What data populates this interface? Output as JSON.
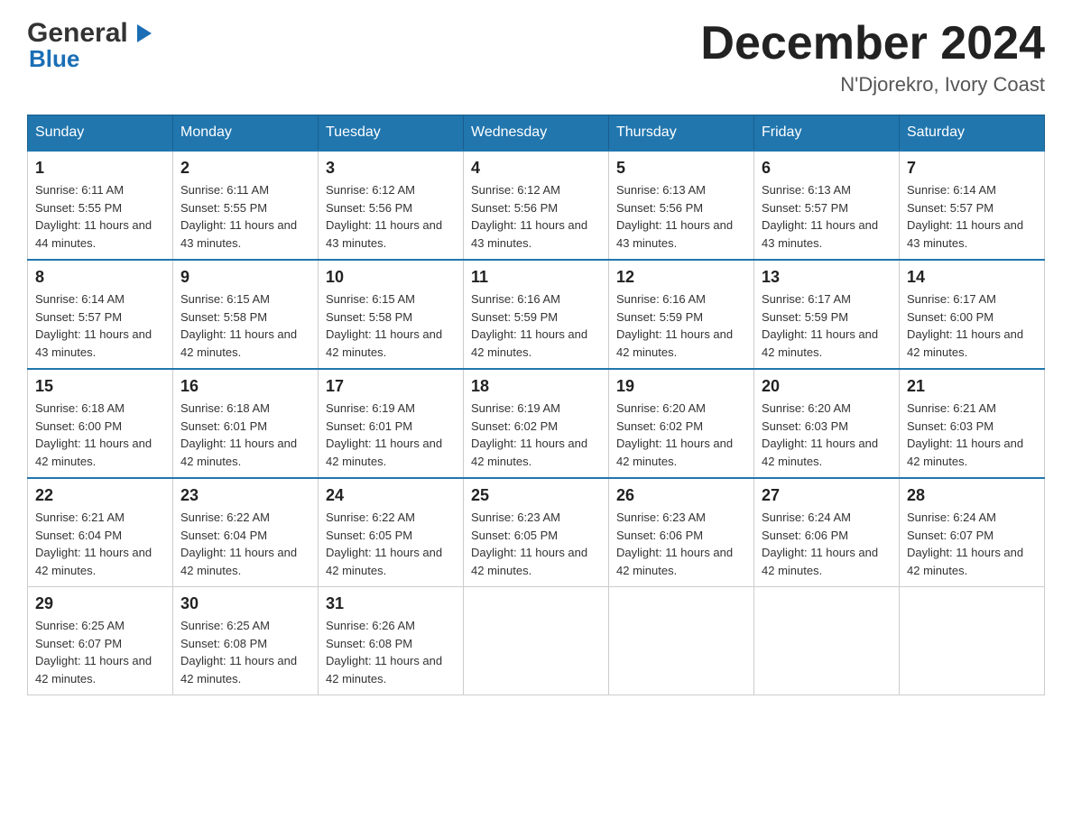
{
  "header": {
    "logo": {
      "general": "General",
      "blue": "Blue",
      "arrow_symbol": "▶"
    },
    "title": "December 2024",
    "location": "N'Djorekro, Ivory Coast"
  },
  "calendar": {
    "days_of_week": [
      "Sunday",
      "Monday",
      "Tuesday",
      "Wednesday",
      "Thursday",
      "Friday",
      "Saturday"
    ],
    "weeks": [
      [
        {
          "day": "1",
          "sunrise": "Sunrise: 6:11 AM",
          "sunset": "Sunset: 5:55 PM",
          "daylight": "Daylight: 11 hours and 44 minutes."
        },
        {
          "day": "2",
          "sunrise": "Sunrise: 6:11 AM",
          "sunset": "Sunset: 5:55 PM",
          "daylight": "Daylight: 11 hours and 43 minutes."
        },
        {
          "day": "3",
          "sunrise": "Sunrise: 6:12 AM",
          "sunset": "Sunset: 5:56 PM",
          "daylight": "Daylight: 11 hours and 43 minutes."
        },
        {
          "day": "4",
          "sunrise": "Sunrise: 6:12 AM",
          "sunset": "Sunset: 5:56 PM",
          "daylight": "Daylight: 11 hours and 43 minutes."
        },
        {
          "day": "5",
          "sunrise": "Sunrise: 6:13 AM",
          "sunset": "Sunset: 5:56 PM",
          "daylight": "Daylight: 11 hours and 43 minutes."
        },
        {
          "day": "6",
          "sunrise": "Sunrise: 6:13 AM",
          "sunset": "Sunset: 5:57 PM",
          "daylight": "Daylight: 11 hours and 43 minutes."
        },
        {
          "day": "7",
          "sunrise": "Sunrise: 6:14 AM",
          "sunset": "Sunset: 5:57 PM",
          "daylight": "Daylight: 11 hours and 43 minutes."
        }
      ],
      [
        {
          "day": "8",
          "sunrise": "Sunrise: 6:14 AM",
          "sunset": "Sunset: 5:57 PM",
          "daylight": "Daylight: 11 hours and 43 minutes."
        },
        {
          "day": "9",
          "sunrise": "Sunrise: 6:15 AM",
          "sunset": "Sunset: 5:58 PM",
          "daylight": "Daylight: 11 hours and 42 minutes."
        },
        {
          "day": "10",
          "sunrise": "Sunrise: 6:15 AM",
          "sunset": "Sunset: 5:58 PM",
          "daylight": "Daylight: 11 hours and 42 minutes."
        },
        {
          "day": "11",
          "sunrise": "Sunrise: 6:16 AM",
          "sunset": "Sunset: 5:59 PM",
          "daylight": "Daylight: 11 hours and 42 minutes."
        },
        {
          "day": "12",
          "sunrise": "Sunrise: 6:16 AM",
          "sunset": "Sunset: 5:59 PM",
          "daylight": "Daylight: 11 hours and 42 minutes."
        },
        {
          "day": "13",
          "sunrise": "Sunrise: 6:17 AM",
          "sunset": "Sunset: 5:59 PM",
          "daylight": "Daylight: 11 hours and 42 minutes."
        },
        {
          "day": "14",
          "sunrise": "Sunrise: 6:17 AM",
          "sunset": "Sunset: 6:00 PM",
          "daylight": "Daylight: 11 hours and 42 minutes."
        }
      ],
      [
        {
          "day": "15",
          "sunrise": "Sunrise: 6:18 AM",
          "sunset": "Sunset: 6:00 PM",
          "daylight": "Daylight: 11 hours and 42 minutes."
        },
        {
          "day": "16",
          "sunrise": "Sunrise: 6:18 AM",
          "sunset": "Sunset: 6:01 PM",
          "daylight": "Daylight: 11 hours and 42 minutes."
        },
        {
          "day": "17",
          "sunrise": "Sunrise: 6:19 AM",
          "sunset": "Sunset: 6:01 PM",
          "daylight": "Daylight: 11 hours and 42 minutes."
        },
        {
          "day": "18",
          "sunrise": "Sunrise: 6:19 AM",
          "sunset": "Sunset: 6:02 PM",
          "daylight": "Daylight: 11 hours and 42 minutes."
        },
        {
          "day": "19",
          "sunrise": "Sunrise: 6:20 AM",
          "sunset": "Sunset: 6:02 PM",
          "daylight": "Daylight: 11 hours and 42 minutes."
        },
        {
          "day": "20",
          "sunrise": "Sunrise: 6:20 AM",
          "sunset": "Sunset: 6:03 PM",
          "daylight": "Daylight: 11 hours and 42 minutes."
        },
        {
          "day": "21",
          "sunrise": "Sunrise: 6:21 AM",
          "sunset": "Sunset: 6:03 PM",
          "daylight": "Daylight: 11 hours and 42 minutes."
        }
      ],
      [
        {
          "day": "22",
          "sunrise": "Sunrise: 6:21 AM",
          "sunset": "Sunset: 6:04 PM",
          "daylight": "Daylight: 11 hours and 42 minutes."
        },
        {
          "day": "23",
          "sunrise": "Sunrise: 6:22 AM",
          "sunset": "Sunset: 6:04 PM",
          "daylight": "Daylight: 11 hours and 42 minutes."
        },
        {
          "day": "24",
          "sunrise": "Sunrise: 6:22 AM",
          "sunset": "Sunset: 6:05 PM",
          "daylight": "Daylight: 11 hours and 42 minutes."
        },
        {
          "day": "25",
          "sunrise": "Sunrise: 6:23 AM",
          "sunset": "Sunset: 6:05 PM",
          "daylight": "Daylight: 11 hours and 42 minutes."
        },
        {
          "day": "26",
          "sunrise": "Sunrise: 6:23 AM",
          "sunset": "Sunset: 6:06 PM",
          "daylight": "Daylight: 11 hours and 42 minutes."
        },
        {
          "day": "27",
          "sunrise": "Sunrise: 6:24 AM",
          "sunset": "Sunset: 6:06 PM",
          "daylight": "Daylight: 11 hours and 42 minutes."
        },
        {
          "day": "28",
          "sunrise": "Sunrise: 6:24 AM",
          "sunset": "Sunset: 6:07 PM",
          "daylight": "Daylight: 11 hours and 42 minutes."
        }
      ],
      [
        {
          "day": "29",
          "sunrise": "Sunrise: 6:25 AM",
          "sunset": "Sunset: 6:07 PM",
          "daylight": "Daylight: 11 hours and 42 minutes."
        },
        {
          "day": "30",
          "sunrise": "Sunrise: 6:25 AM",
          "sunset": "Sunset: 6:08 PM",
          "daylight": "Daylight: 11 hours and 42 minutes."
        },
        {
          "day": "31",
          "sunrise": "Sunrise: 6:26 AM",
          "sunset": "Sunset: 6:08 PM",
          "daylight": "Daylight: 11 hours and 42 minutes."
        },
        {
          "day": "",
          "sunrise": "",
          "sunset": "",
          "daylight": ""
        },
        {
          "day": "",
          "sunrise": "",
          "sunset": "",
          "daylight": ""
        },
        {
          "day": "",
          "sunrise": "",
          "sunset": "",
          "daylight": ""
        },
        {
          "day": "",
          "sunrise": "",
          "sunset": "",
          "daylight": ""
        }
      ]
    ]
  }
}
